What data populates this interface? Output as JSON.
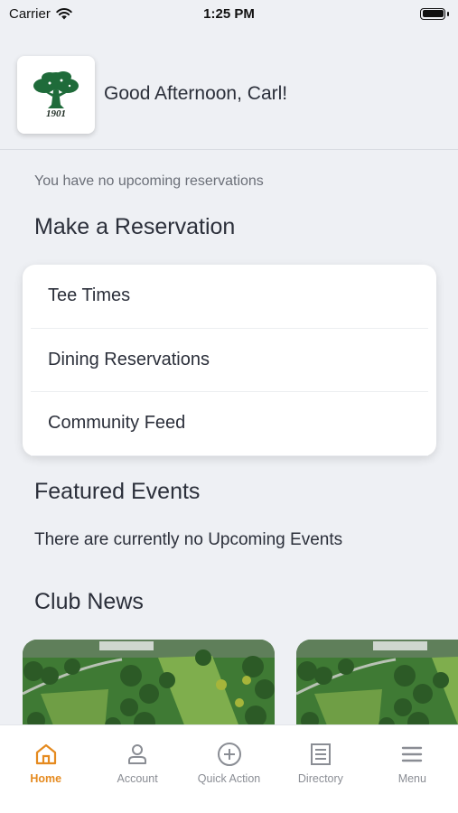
{
  "status_bar": {
    "carrier": "Carrier",
    "time": "1:25 PM"
  },
  "header": {
    "logo_year": "1901",
    "greeting": "Good Afternoon, Carl!"
  },
  "reservations": {
    "empty_text": "You have no upcoming reservations",
    "title": "Make a Reservation",
    "items": [
      {
        "label": "Tee Times"
      },
      {
        "label": "Dining Reservations"
      },
      {
        "label": "Community Feed"
      }
    ]
  },
  "events": {
    "title": "Featured Events",
    "empty_text": "There are currently no Upcoming Events"
  },
  "news": {
    "title": "Club News"
  },
  "tabbar": {
    "accent_color": "#e58a1f",
    "tabs": [
      {
        "label": "Home",
        "icon": "home-icon",
        "active": true
      },
      {
        "label": "Account",
        "icon": "person-icon",
        "active": false
      },
      {
        "label": "Quick Action",
        "icon": "plus-circle-icon",
        "active": false
      },
      {
        "label": "Directory",
        "icon": "directory-icon",
        "active": false
      },
      {
        "label": "Menu",
        "icon": "hamburger-menu-icon",
        "active": false
      }
    ]
  }
}
